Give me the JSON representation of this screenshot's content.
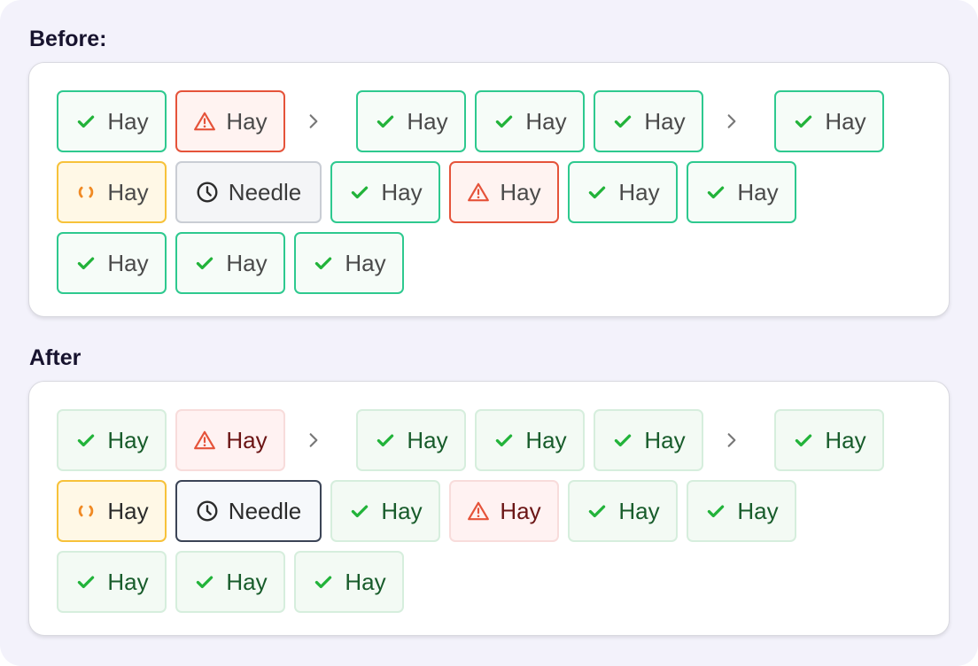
{
  "sections": [
    {
      "title": "Before:",
      "rows": [
        [
          {
            "kind": "hay",
            "icon": "check-icon",
            "label": "Hay"
          },
          {
            "kind": "warn",
            "icon": "warning-icon",
            "label": "Hay"
          },
          {
            "kind": "sep",
            "icon": "chevron-right-icon"
          },
          {
            "kind": "hay",
            "icon": "check-icon",
            "label": "Hay"
          },
          {
            "kind": "hay",
            "icon": "check-icon",
            "label": "Hay"
          },
          {
            "kind": "hay",
            "icon": "check-icon",
            "label": "Hay"
          },
          {
            "kind": "sep",
            "icon": "chevron-right-icon"
          },
          {
            "kind": "hay",
            "icon": "check-icon",
            "label": "Hay"
          }
        ],
        [
          {
            "kind": "wait",
            "icon": "spinner-icon",
            "label": "Hay"
          },
          {
            "kind": "needle",
            "icon": "clock-icon",
            "label": "Needle"
          },
          {
            "kind": "hay",
            "icon": "check-icon",
            "label": "Hay"
          },
          {
            "kind": "warn",
            "icon": "warning-icon",
            "label": "Hay"
          },
          {
            "kind": "hay",
            "icon": "check-icon",
            "label": "Hay"
          },
          {
            "kind": "hay",
            "icon": "check-icon",
            "label": "Hay"
          }
        ],
        [
          {
            "kind": "hay",
            "icon": "check-icon",
            "label": "Hay"
          },
          {
            "kind": "hay",
            "icon": "check-icon",
            "label": "Hay"
          },
          {
            "kind": "hay",
            "icon": "check-icon",
            "label": "Hay"
          }
        ]
      ]
    },
    {
      "title": "After",
      "rows": [
        [
          {
            "kind": "hay",
            "icon": "check-icon",
            "label": "Hay"
          },
          {
            "kind": "warn",
            "icon": "warning-icon",
            "label": "Hay"
          },
          {
            "kind": "sep",
            "icon": "chevron-right-icon"
          },
          {
            "kind": "hay",
            "icon": "check-icon",
            "label": "Hay"
          },
          {
            "kind": "hay",
            "icon": "check-icon",
            "label": "Hay"
          },
          {
            "kind": "hay",
            "icon": "check-icon",
            "label": "Hay"
          },
          {
            "kind": "sep",
            "icon": "chevron-right-icon"
          },
          {
            "kind": "hay",
            "icon": "check-icon",
            "label": "Hay"
          }
        ],
        [
          {
            "kind": "wait",
            "icon": "spinner-icon",
            "label": "Hay"
          },
          {
            "kind": "needle",
            "icon": "clock-icon",
            "label": "Needle"
          },
          {
            "kind": "hay",
            "icon": "check-icon",
            "label": "Hay"
          },
          {
            "kind": "warn",
            "icon": "warning-icon",
            "label": "Hay"
          },
          {
            "kind": "hay",
            "icon": "check-icon",
            "label": "Hay"
          },
          {
            "kind": "hay",
            "icon": "check-icon",
            "label": "Hay"
          }
        ],
        [
          {
            "kind": "hay",
            "icon": "check-icon",
            "label": "Hay"
          },
          {
            "kind": "hay",
            "icon": "check-icon",
            "label": "Hay"
          },
          {
            "kind": "hay",
            "icon": "check-icon",
            "label": "Hay"
          }
        ]
      ]
    }
  ],
  "colors": {
    "success": "#22b33a",
    "danger": "#e5533a",
    "pending": "#f08a24",
    "neutral": "#2b2b2b",
    "separator": "#777777"
  }
}
